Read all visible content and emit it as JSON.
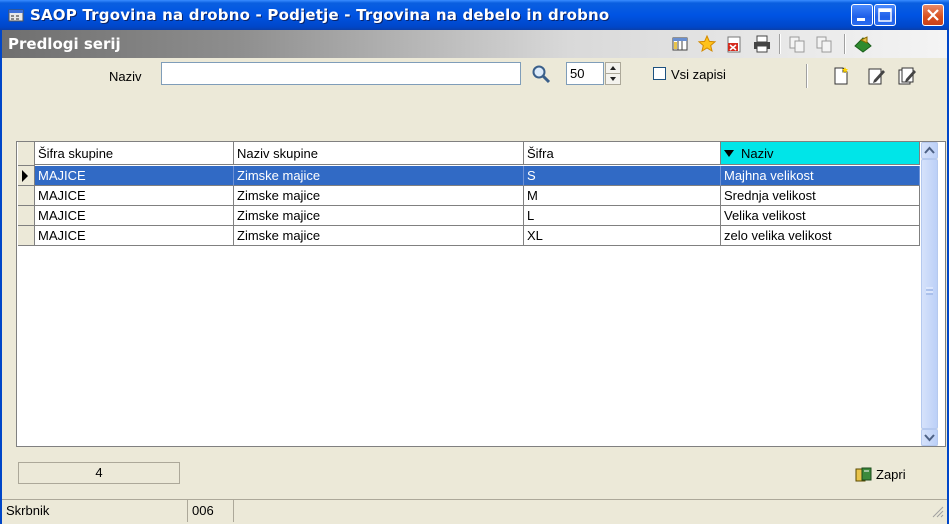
{
  "window": {
    "title": "SAOP Trgovina na drobno - Podjetje - Trgovina na debelo in drobno"
  },
  "module": {
    "title": "Predlogi serij",
    "toolbar_icons": [
      "columns-icon",
      "star-icon",
      "export-icon",
      "print-icon",
      "copy-icon",
      "paste-icon",
      "exit-icon"
    ]
  },
  "search": {
    "label": "Naziv",
    "value": "",
    "count": "50",
    "all_records_label": "Vsi zapisi",
    "all_records_checked": false,
    "action_icons": [
      "new-record-icon",
      "edit-record-icon",
      "edit-multiple-icon",
      "search-icon"
    ]
  },
  "grid": {
    "columns": [
      "Šifra skupine",
      "Naziv skupine",
      "Šifra",
      "Naziv"
    ],
    "sorted_column": "Naziv",
    "sort_direction": "descending",
    "rows": [
      {
        "sifra_skupine": "MAJICE",
        "naziv_skupine": "Zimske majice",
        "sifra": "S",
        "naziv": "Majhna velikost",
        "selected": true
      },
      {
        "sifra_skupine": "MAJICE",
        "naziv_skupine": "Zimske majice",
        "sifra": "M",
        "naziv": "Srednja velikost",
        "selected": false
      },
      {
        "sifra_skupine": "MAJICE",
        "naziv_skupine": "Zimske majice",
        "sifra": "L",
        "naziv": "Velika velikost",
        "selected": false
      },
      {
        "sifra_skupine": "MAJICE",
        "naziv_skupine": "Zimske majice",
        "sifra": "XL",
        "naziv": "zelo velika velikost",
        "selected": false
      }
    ]
  },
  "footer": {
    "record_count": "4",
    "close_label": "Zapri"
  },
  "status": {
    "user": "Skrbnik",
    "code": "006"
  },
  "colors": {
    "title_bar": "#0054E3",
    "selection": "#316AC5",
    "sorted_header": "#00E5E8",
    "face": "#ECE9D8"
  }
}
